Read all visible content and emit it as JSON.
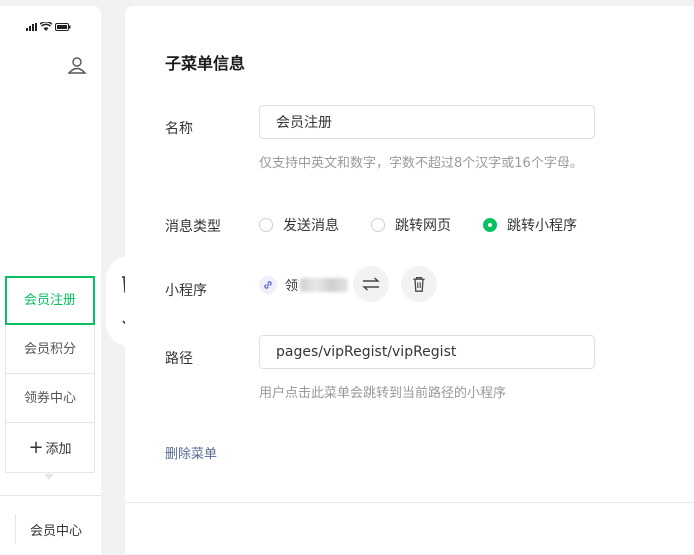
{
  "phone": {
    "submenu": [
      {
        "label": "会员注册",
        "active": true
      },
      {
        "label": "会员积分",
        "active": false
      },
      {
        "label": "领券中心",
        "active": false
      }
    ],
    "add_label": "添加",
    "bottom_menu": "会员中心"
  },
  "form": {
    "title": "子菜单信息",
    "name_label": "名称",
    "name_value": "会员注册",
    "name_hint": "仅支持中英文和数字，字数不超过8个汉字或16个字母。",
    "msg_type_label": "消息类型",
    "msg_types": [
      {
        "label": "发送消息",
        "checked": false
      },
      {
        "label": "跳转网页",
        "checked": false
      },
      {
        "label": "跳转小程序",
        "checked": true
      }
    ],
    "miniprogram_label": "小程序",
    "miniprogram_name": "领",
    "path_label": "路径",
    "path_value": "pages/vipRegist/vipRegist",
    "path_hint": "用户点击此菜单会跳转到当前路径的小程序",
    "delete_label": "删除菜单"
  },
  "colors": {
    "accent": "#07c160",
    "link": "#576b95"
  },
  "icons": {
    "tools": [
      "trash-icon",
      "arrow-down-icon"
    ],
    "miniprogram": [
      "link-icon",
      "swap-icon",
      "trash-icon"
    ]
  }
}
